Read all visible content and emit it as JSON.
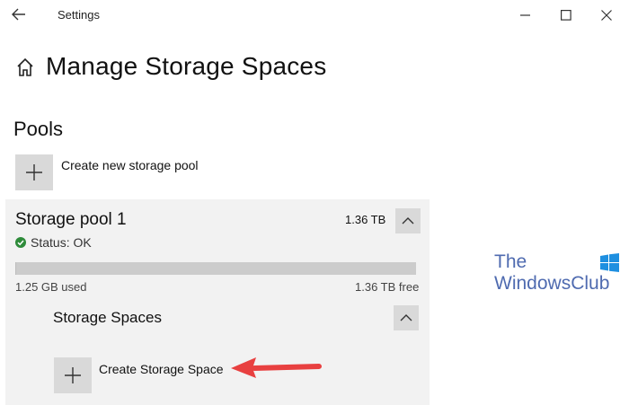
{
  "window": {
    "title": "Settings",
    "controls": [
      "minimize",
      "maximize",
      "close"
    ]
  },
  "page": {
    "title": "Manage Storage Spaces",
    "home_icon": "home-icon"
  },
  "pools": {
    "section_title": "Pools",
    "create_pool_label": "Create new storage pool",
    "pool": {
      "name": "Storage pool 1",
      "size": "1.36 TB",
      "status": "Status: OK",
      "used": "1.25 GB used",
      "free": "1.36 TB free",
      "usage_fraction": 0.001
    }
  },
  "storage_spaces": {
    "title": "Storage Spaces",
    "create_label": "Create Storage Space"
  },
  "watermark": {
    "line1": "The",
    "line2": "WindowsClub"
  },
  "colors": {
    "accent_red": "#e84040",
    "status_green": "#2e8b3a",
    "logo_blue": "#4f6bb0",
    "tile_gray": "#d9d9d9",
    "panel_gray": "#f2f2f2"
  }
}
